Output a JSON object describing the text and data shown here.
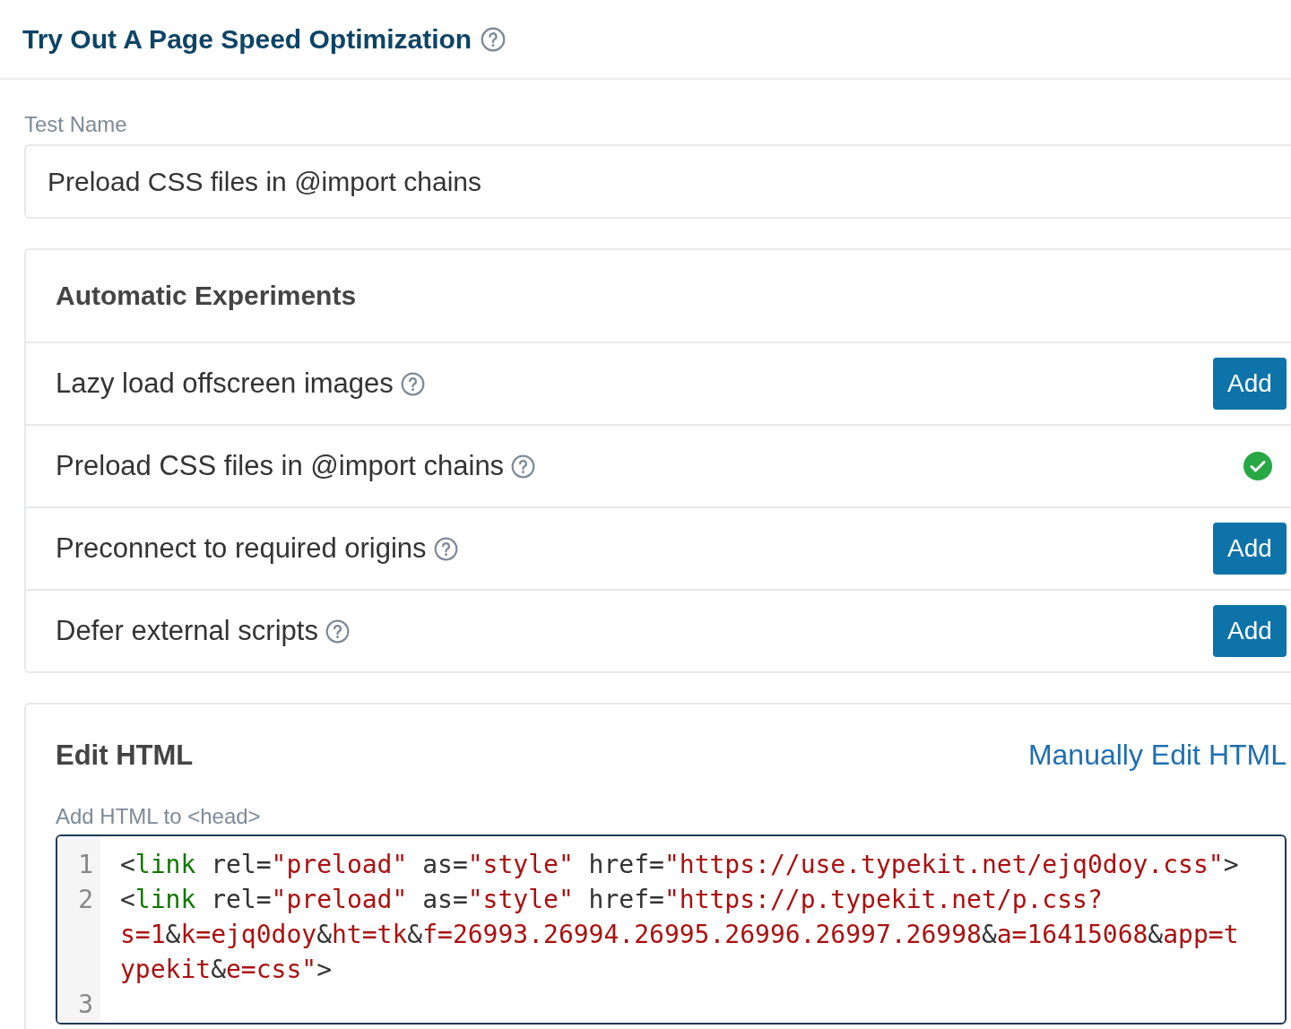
{
  "header": {
    "title": "Try Out A Page Speed Optimization"
  },
  "test_name": {
    "label": "Test Name",
    "value": "Preload CSS files in @import chains"
  },
  "experiments": {
    "title": "Automatic Experiments",
    "items": [
      {
        "label": "Lazy load offscreen images",
        "added": false,
        "button": "Add"
      },
      {
        "label": "Preload CSS files in @import chains",
        "added": true
      },
      {
        "label": "Preconnect to required origins",
        "added": false,
        "button": "Add"
      },
      {
        "label": "Defer external scripts",
        "added": false,
        "button": "Add"
      }
    ]
  },
  "edit_html": {
    "title": "Edit HTML",
    "link": "Manually Edit HTML",
    "editor_label": "Add HTML to <head>",
    "lines": [
      {
        "number": "1",
        "tokens": [
          {
            "kind": "plain",
            "text": "<"
          },
          {
            "kind": "tag",
            "text": "link"
          },
          {
            "kind": "plain",
            "text": " rel="
          },
          {
            "kind": "string",
            "text": "\"preload\""
          },
          {
            "kind": "plain",
            "text": " as="
          },
          {
            "kind": "string",
            "text": "\"style\""
          },
          {
            "kind": "plain",
            "text": " href="
          },
          {
            "kind": "string",
            "text": "\"https://use.typekit.net/ejq0doy.css\""
          },
          {
            "kind": "plain",
            "text": ">"
          }
        ]
      },
      {
        "number": "2",
        "tokens": [
          {
            "kind": "plain",
            "text": "<"
          },
          {
            "kind": "tag",
            "text": "link"
          },
          {
            "kind": "plain",
            "text": " rel="
          },
          {
            "kind": "string",
            "text": "\"preload\""
          },
          {
            "kind": "plain",
            "text": " as="
          },
          {
            "kind": "string",
            "text": "\"style\""
          },
          {
            "kind": "plain",
            "text": " href="
          },
          {
            "kind": "string",
            "text": "\"https://p.typekit.net/p.css?s=1"
          },
          {
            "kind": "plain",
            "text": "&"
          },
          {
            "kind": "string",
            "text": "k=ejq0doy"
          },
          {
            "kind": "plain",
            "text": "&"
          },
          {
            "kind": "string",
            "text": "ht=tk"
          },
          {
            "kind": "plain",
            "text": "&"
          },
          {
            "kind": "string",
            "text": "f=26993.26994.26995.26996.26997.26998"
          },
          {
            "kind": "plain",
            "text": "&"
          },
          {
            "kind": "string",
            "text": "a=16415068"
          },
          {
            "kind": "plain",
            "text": "&"
          },
          {
            "kind": "string",
            "text": "app=typekit"
          },
          {
            "kind": "plain",
            "text": "&"
          },
          {
            "kind": "string",
            "text": "e=css\""
          },
          {
            "kind": "plain",
            "text": ">"
          }
        ]
      },
      {
        "number": "3"
      }
    ]
  }
}
